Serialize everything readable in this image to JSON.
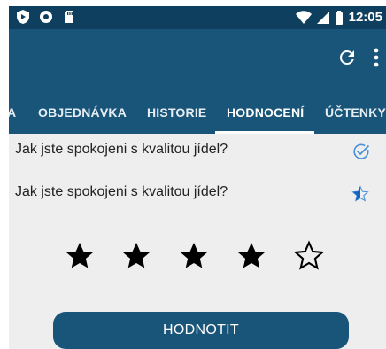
{
  "status_bar": {
    "time": "12:05",
    "left_icons": [
      "play-shield-icon",
      "circle-dot-icon",
      "sd-card-icon"
    ],
    "right_icons": [
      "wifi-icon",
      "signal-icon",
      "battery-icon"
    ]
  },
  "app_bar": {
    "actions": [
      "refresh-icon",
      "more-vert-icon"
    ]
  },
  "tabs": [
    {
      "label": "A",
      "active": false
    },
    {
      "label": "OBJEDNÁVKA",
      "active": false
    },
    {
      "label": "HISTORIE",
      "active": false
    },
    {
      "label": "HODNOCENÍ",
      "active": true
    },
    {
      "label": "ÚČTENKY",
      "active": false
    }
  ],
  "questions": [
    {
      "label": "Jak jste spokojeni s kvalitou jídel?",
      "icon": "check-circle-icon"
    },
    {
      "label": "Jak jste spokojeni s kvalitou jídel?",
      "icon": "star-half-icon"
    }
  ],
  "rating": {
    "value": 4,
    "max": 5
  },
  "submit_label": "HODNOTIT",
  "colors": {
    "status_bar": "#0f3f5f",
    "primary": "#195479",
    "accent": "#4a90d9",
    "background": "#eeeeee"
  }
}
